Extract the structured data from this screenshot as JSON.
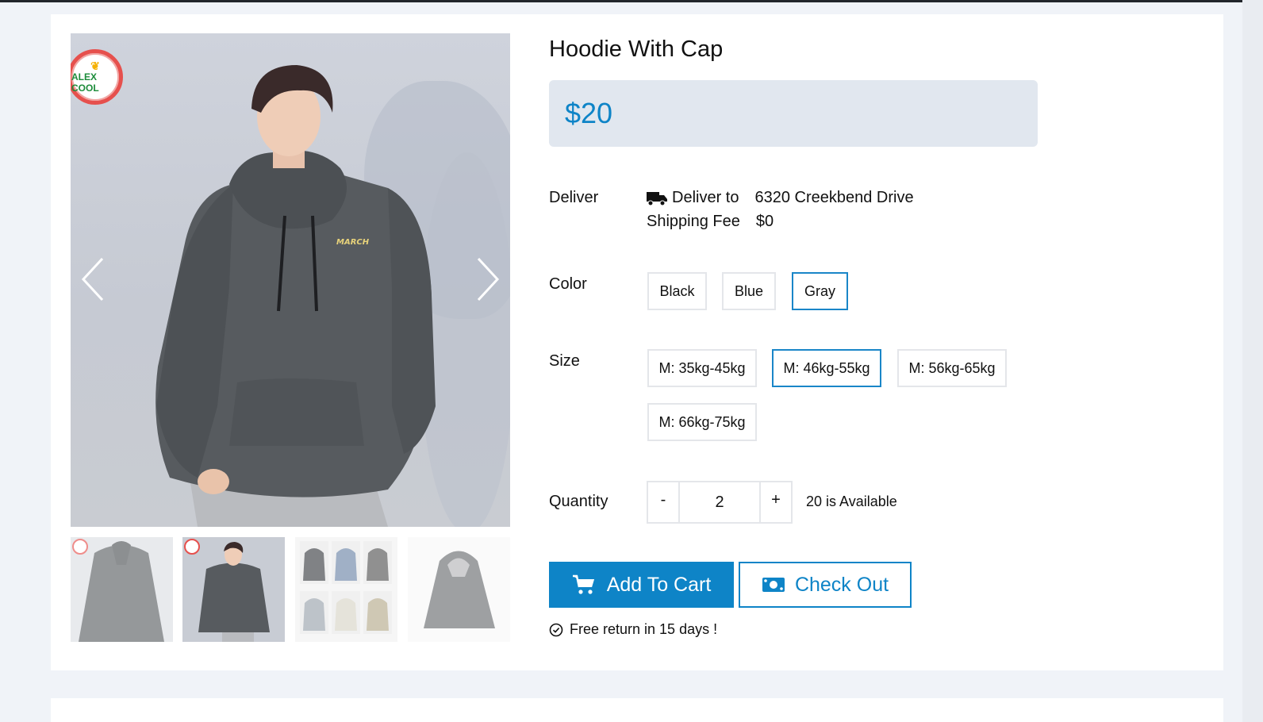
{
  "product": {
    "title": "Hoodie With Cap",
    "price": "$20",
    "brand_logo_text": "ALEX COOL"
  },
  "delivery": {
    "label": "Deliver",
    "deliver_to_label": "Deliver to",
    "address": "6320 Creekbend Drive",
    "shipping_fee_label": "Shipping Fee",
    "shipping_fee": "$0"
  },
  "color": {
    "label": "Color",
    "options": [
      "Black",
      "Blue",
      "Gray"
    ],
    "selected": "Gray"
  },
  "size": {
    "label": "Size",
    "options": [
      "M: 35kg-45kg",
      "M: 46kg-55kg",
      "M: 56kg-65kg",
      "M: 66kg-75kg"
    ],
    "selected": "M: 46kg-55kg"
  },
  "quantity": {
    "label": "Quantity",
    "minus": "-",
    "plus": "+",
    "value": "2",
    "available": "20 is Available"
  },
  "actions": {
    "add_to_cart": "Add To Cart",
    "check_out": "Check Out"
  },
  "return_note": "Free return in 15 days !",
  "gallery": {
    "main_print": "MARCH",
    "icons": {
      "prev": "chevron-left-icon",
      "next": "chevron-right-icon",
      "cart": "cart-icon",
      "money": "money-icon",
      "truck": "truck-icon",
      "check": "check-circle-icon"
    }
  },
  "colors": {
    "accent": "#0e84c7",
    "price_bg": "#e1e7ef",
    "page_bg": "#f0f3f8",
    "hoodie": "#575b5f"
  }
}
